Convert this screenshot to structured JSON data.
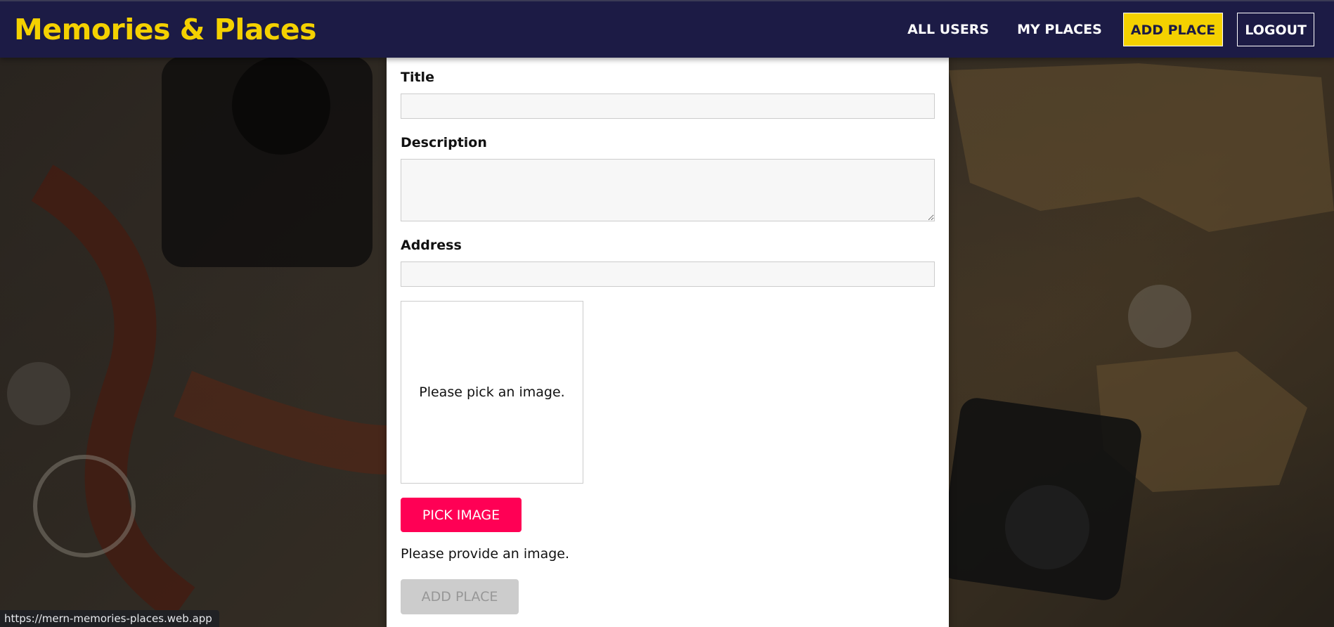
{
  "header": {
    "brand": "Memories & Places",
    "nav": {
      "all_users": "ALL USERS",
      "my_places": "MY PLACES",
      "add_place": "ADD PLACE",
      "logout": "LOGOUT"
    }
  },
  "form": {
    "title": {
      "label": "Title",
      "value": ""
    },
    "description": {
      "label": "Description",
      "value": ""
    },
    "address": {
      "label": "Address",
      "value": ""
    },
    "image": {
      "preview_text": "Please pick an image.",
      "pick_button": "PICK IMAGE",
      "error_text": "Please provide an image."
    },
    "submit": {
      "label": "ADD PLACE",
      "disabled": true
    }
  },
  "status_bar": {
    "url": "https://mern-memories-places.web.app"
  },
  "colors": {
    "header_bg": "#1c1b45",
    "brand": "#f4d100",
    "active_nav_bg": "#f4d100",
    "pick_button": "#ff0055",
    "submit_disabled": "#cccccc"
  },
  "icons": {
    "background": "travel-map-photo"
  }
}
